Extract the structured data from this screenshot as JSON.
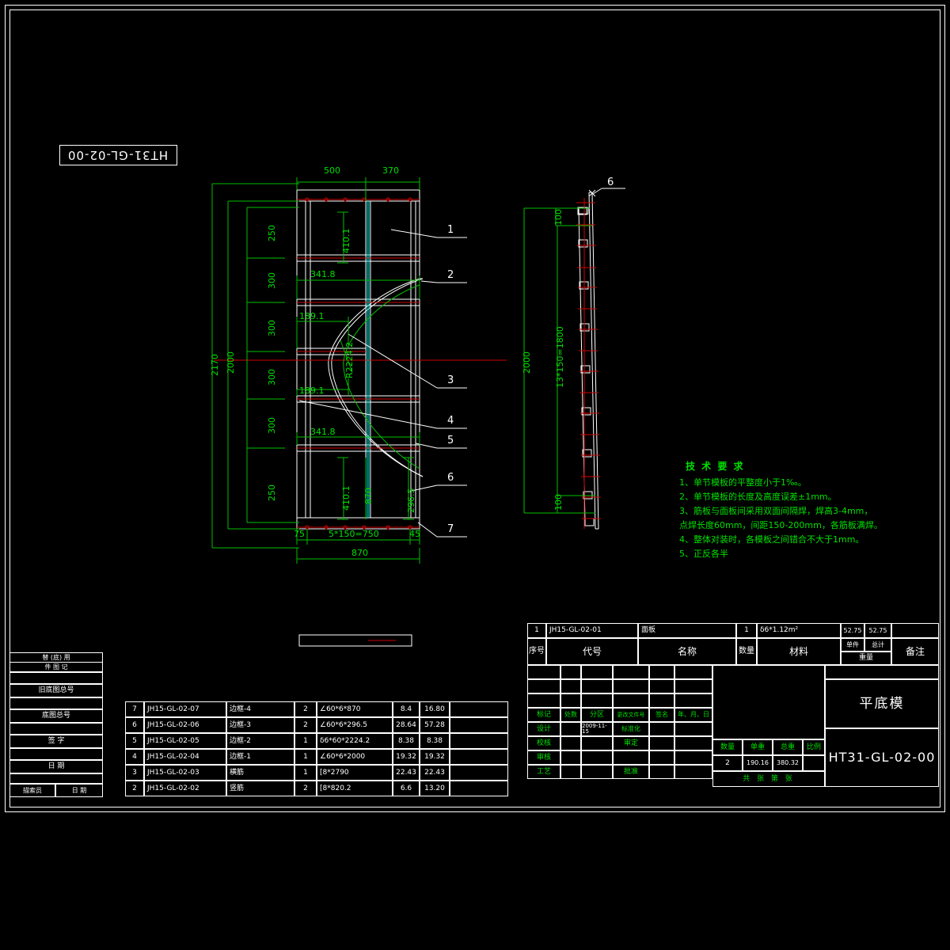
{
  "sheet": {
    "drawing_number_top_left": "HT31-GL-02-00",
    "background_color": "#000000",
    "line_color_white": "#ffffff",
    "line_color_green": "#00e000",
    "line_color_red": "#d00000",
    "line_color_cyan": "#00d8d8"
  },
  "front_view": {
    "dims_top": [
      "500",
      "370"
    ],
    "dims_left_outer": [
      "2170",
      "2000"
    ],
    "dims_left_chain": [
      "250",
      "300",
      "300",
      "300",
      "300",
      "250"
    ],
    "dims_inner": [
      "341.8",
      "189.1",
      "189.1",
      "341.8"
    ],
    "dims_vertical_inner": [
      "410.1",
      "410.1"
    ],
    "dim_radius": "R2224.2",
    "dim_mid_width": "870",
    "dim_right_inner": "296.5",
    "dims_bottom_chain": [
      "75",
      "5*150=750",
      "45"
    ],
    "dim_bottom_total": "870",
    "callouts": [
      "1",
      "2",
      "3",
      "4",
      "5",
      "6",
      "7"
    ]
  },
  "side_view": {
    "callout_top": "6",
    "dim_total": "2000",
    "dim_top": "100",
    "dim_middle": "13*150=1800",
    "dim_bottom": "100"
  },
  "tech_notes": {
    "title": "技 术 要 求",
    "lines": [
      "1、单节模板的平整度小于1‰。",
      "2、单节模板的长度及高度误差±1mm。",
      "3、筋板与面板间采用双面间隔焊，焊高3-4mm，",
      "   点焊长度60mm，间距150-200mm，各筋板满焊。",
      "4、整体对装时，各模板之间错合不大于1mm。",
      "5、正反各半"
    ]
  },
  "parts_list": {
    "headers": [
      "序号",
      "代号",
      "名称",
      "数量",
      "材料",
      "单件",
      "总计",
      "备注"
    ],
    "header_weight_label": "重量",
    "rows_lower": [
      {
        "no": "7",
        "code": "JH15-GL-02-07",
        "name": "边框-4",
        "qty": "2",
        "material": "∠60*6*870",
        "unit_w": "8.4",
        "total_w": "16.80",
        "remark": ""
      },
      {
        "no": "6",
        "code": "JH15-GL-02-06",
        "name": "边框-3",
        "qty": "2",
        "material": "∠60*6*296.5",
        "unit_w": "28.64",
        "total_w": "57.28",
        "remark": ""
      },
      {
        "no": "5",
        "code": "JH15-GL-02-05",
        "name": "边框-2",
        "qty": "1",
        "material": "δ6*60*2224.2",
        "unit_w": "8.38",
        "total_w": "8.38",
        "remark": ""
      },
      {
        "no": "4",
        "code": "JH15-GL-02-04",
        "name": "边框-1",
        "qty": "1",
        "material": "∠60*6*2000",
        "unit_w": "19.32",
        "total_w": "19.32",
        "remark": ""
      },
      {
        "no": "3",
        "code": "JH15-GL-02-03",
        "name": "横筋",
        "qty": "1",
        "material": "[8*2790",
        "unit_w": "22.43",
        "total_w": "22.43",
        "remark": ""
      },
      {
        "no": "2",
        "code": "JH15-GL-02-02",
        "name": "竖筋",
        "qty": "2",
        "material": "[8*820.2",
        "unit_w": "6.6",
        "total_w": "13.20",
        "remark": ""
      }
    ],
    "row_top": {
      "no": "1",
      "code": "JH15-GL-02-01",
      "name": "面板",
      "qty": "1",
      "material": "δ6*1.12m²",
      "unit_w": "52.75",
      "total_w": "52.75",
      "remark": ""
    }
  },
  "title_block": {
    "revision_headers": [
      "标记",
      "处数",
      "分区",
      "更改文件号",
      "签名",
      "年、月、日"
    ],
    "left_roles": [
      "设计",
      "校核",
      "审核",
      "工艺"
    ],
    "mid_roles": [
      "标准化",
      "审定",
      "",
      "批准"
    ],
    "date_value": "2009-11-15",
    "summary_headers": [
      "数量",
      "单重",
      "总重",
      "比例"
    ],
    "summary_values": [
      "2",
      "190.16",
      "380.32",
      ""
    ],
    "summary_caption": "共 张 第 张",
    "part_name": "平底模",
    "drawing_number": "HT31-GL-02-00"
  },
  "left_margin": {
    "rows": [
      "替 (底) 用",
      "件 图 记",
      "旧底图总号",
      "底图总号",
      "签 字",
      "日 期"
    ],
    "bottom_cells": [
      "描索员",
      "日 期"
    ]
  }
}
